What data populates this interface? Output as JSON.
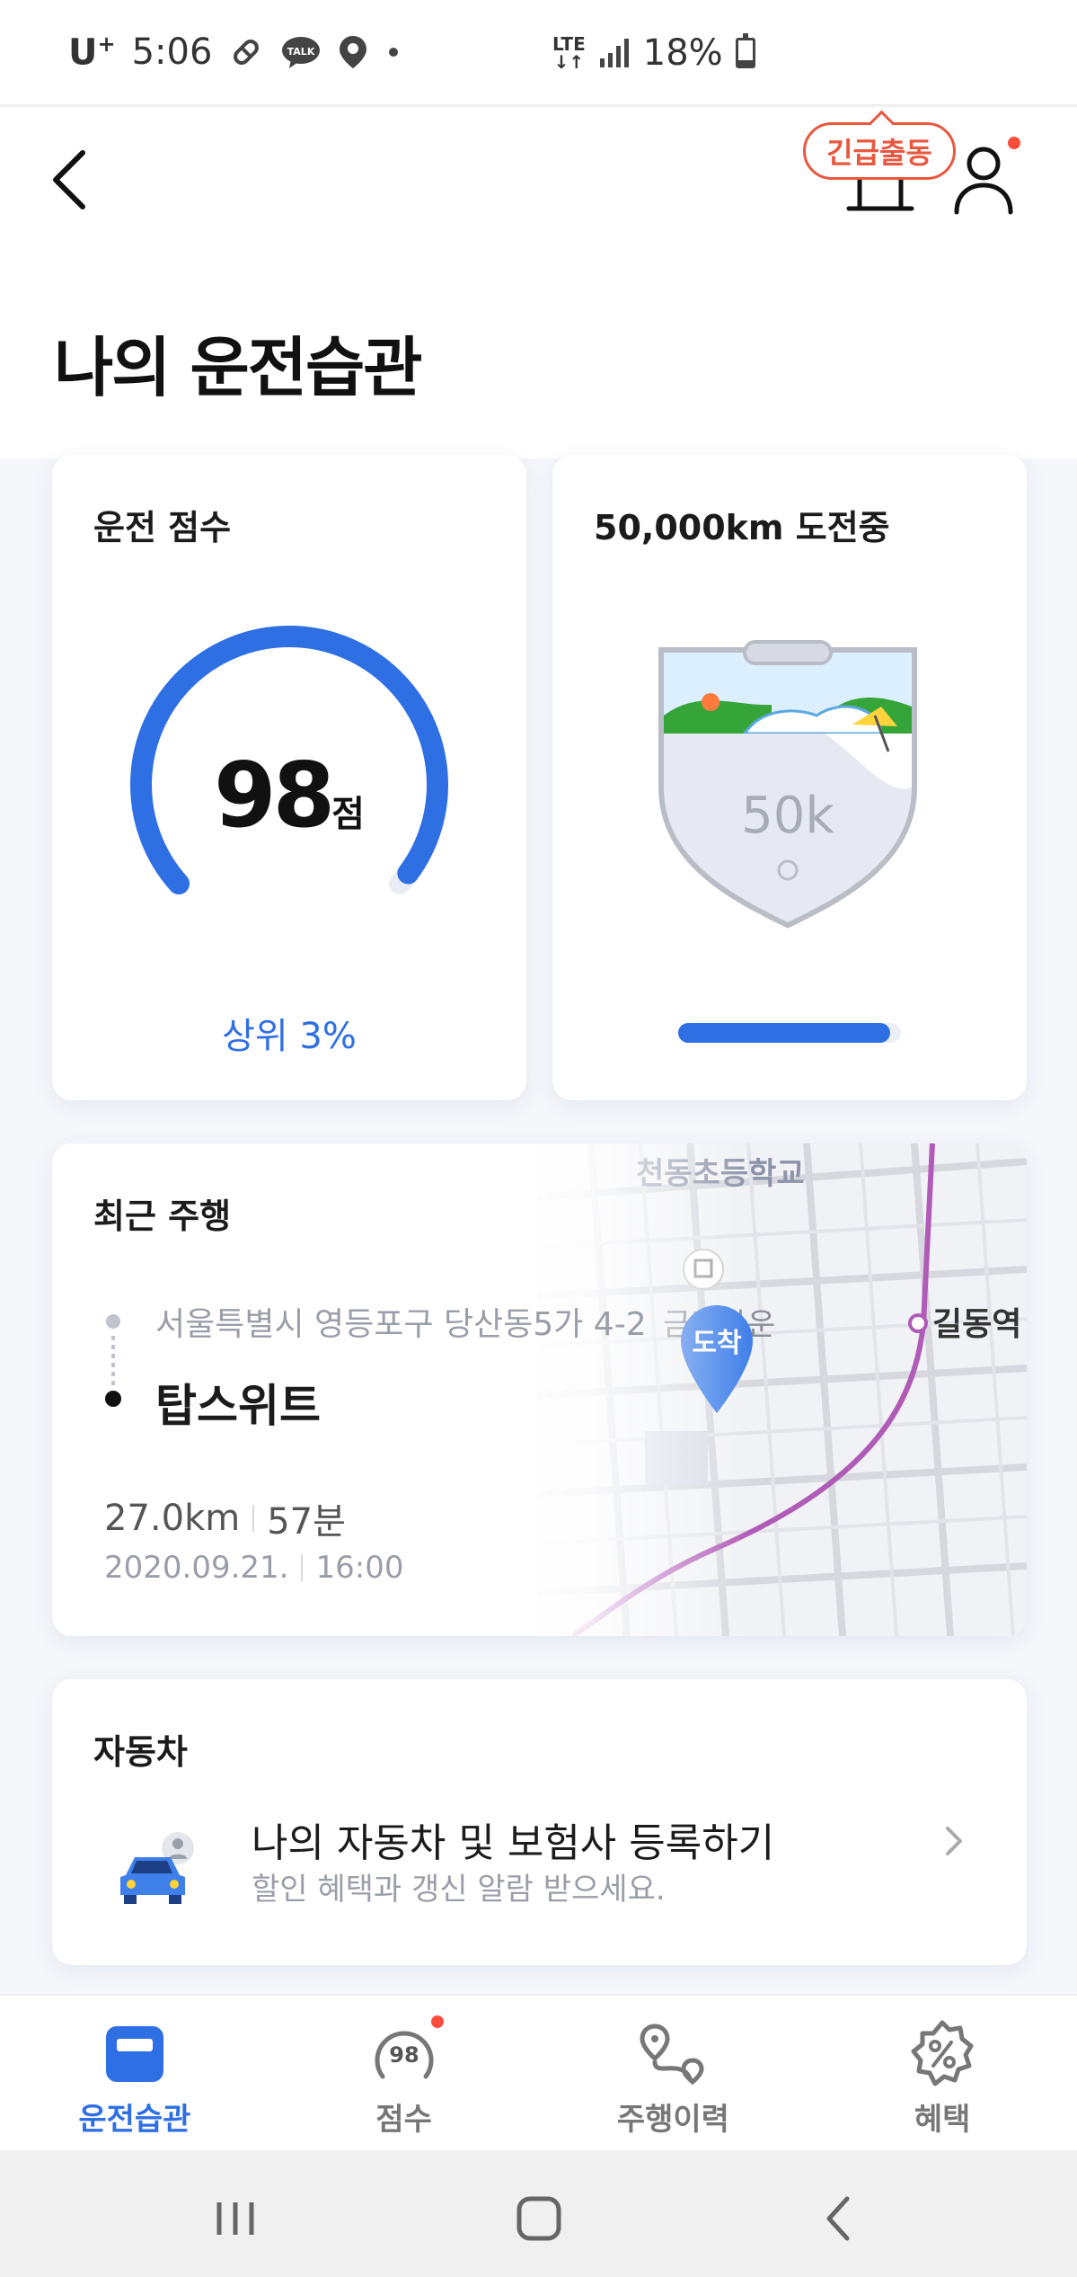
{
  "status_bar": {
    "carrier": "U",
    "carrier_sup": "+",
    "time": "5:06",
    "network": "LTE",
    "battery": "18%"
  },
  "header": {
    "emergency_label": "긴급출동"
  },
  "page_title": "나의 운전습관",
  "score_card": {
    "title": "운전 점수",
    "score": "98",
    "unit": "점",
    "rank": "상위 3%",
    "gauge_fraction": 0.98
  },
  "challenge_card": {
    "title": "50,000km 도전중",
    "badge_label": "50k",
    "progress_fraction": 0.95
  },
  "recent_card": {
    "title": "최근 주행",
    "start_address": "서울특별시 영등포구 당산동5가 4-2",
    "destination": "탑스위트",
    "distance": "27.0km",
    "duration": "57분",
    "date": "2020.09.21.",
    "time": "16:00",
    "map": {
      "school_label": "천동초등학교",
      "place_label": "금홍타운",
      "station_label": "길동역",
      "arrival_pin": "도착"
    }
  },
  "car_card": {
    "title": "자동차",
    "main_text": "나의 자동차 및 보험사 등록하기",
    "sub_text": "할인 혜택과 갱신 알람 받으세요."
  },
  "bottom_nav": {
    "items": [
      {
        "label": "운전습관",
        "icon": "driving-habit-icon"
      },
      {
        "label": "점수",
        "icon": "score-icon",
        "icon_text": "98"
      },
      {
        "label": "주행이력",
        "icon": "route-history-icon"
      },
      {
        "label": "혜택",
        "icon": "benefit-percent-icon"
      }
    ]
  },
  "colors": {
    "accent": "#2f6fe4",
    "emergency": "#e8573f",
    "notification": "#ff4d3d"
  }
}
